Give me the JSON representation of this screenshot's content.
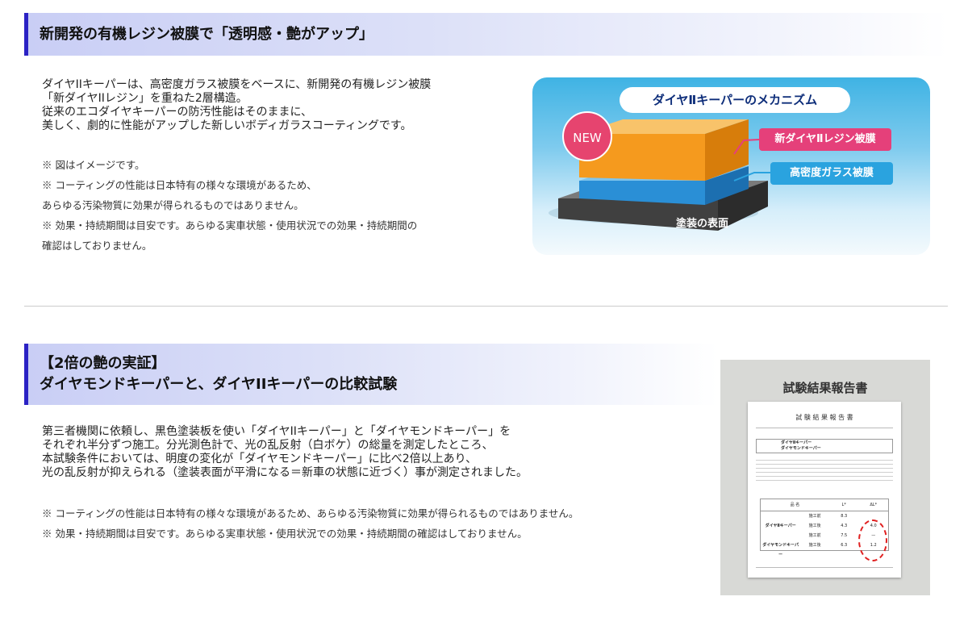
{
  "section1": {
    "heading": "新開発の有機レジン被膜で「透明感・艶がアップ」",
    "body": [
      "ダイヤIIキーパーは、高密度ガラス被膜をベースに、新開発の有機レジン被膜",
      "「新ダイヤIIレジン」を重ねた2層構造。",
      "従来のエコダイヤキーパーの防汚性能はそのままに、",
      "美しく、劇的に性能がアップした新しいボディガラスコーティングです。"
    ],
    "notes": [
      "※ 図はイメージです。",
      "※ コーティングの性能は日本特有の様々な環境があるため、",
      "あらゆる汚染物質に効果が得られるものではありません。",
      "※ 効果・持続期間は目安です。あらゆる実車状態・使用状況での効果・持続期間の",
      "確認はしておりません。"
    ],
    "mechanism": {
      "title": "ダイヤⅡキーパーのメカニズム",
      "badge": "NEW",
      "resin_label": "新ダイヤⅡレジン被膜",
      "glass_label": "高密度ガラス被膜",
      "surface_label": "塗装の表面",
      "colors": {
        "resin": "#f59a1e",
        "glass": "#2a8fd6",
        "surface": "#4a4a4a",
        "accent": "#e5407a"
      }
    }
  },
  "section2": {
    "heading_line1": "【2倍の艶の実証】",
    "heading_line2": "ダイヤモンドキーパーと、ダイヤIIキーパーの比較試験",
    "body": [
      "第三者機関に依頼し、黒色塗装板を使い「ダイヤIIキーパー」と「ダイヤモンドキーパー」を",
      "それぞれ半分ずつ施工。分光測色計で、光の乱反射（白ボケ）の総量を測定したところ、",
      "本試験条件においては、明度の変化が「ダイヤモンドキーパー」に比べ2倍以上あり、",
      "光の乱反射が抑えられる（塗装表面が平滑になる＝新車の状態に近づく）事が測定されました。"
    ],
    "notes": [
      "※ コーティングの性能は日本特有の様々な環境があるため、あらゆる汚染物質に効果が得られるものではありません。",
      "※ 効果・持続期間は目安です。あらゆる実車状態・使用状況での効果・持続期間の確認はしておりません。"
    ],
    "report": {
      "title": "試験結果報告書",
      "doc_title": "試 験 結 果 報 告 書",
      "product_a": "ダイヤⅡキーパー",
      "product_b": "ダイヤモンドキーパー",
      "col_name": "品 名",
      "col_l": "L*",
      "col_dl": "ΔL*",
      "rows": [
        {
          "label": "施工前",
          "l": "8.3",
          "dl": ""
        },
        {
          "label": "施工後",
          "l": "4.3",
          "dl": "4.0"
        },
        {
          "label": "施工前",
          "l": "7.5",
          "dl": "—"
        },
        {
          "label": "施工後",
          "l": "6.3",
          "dl": "1.2"
        }
      ]
    }
  }
}
